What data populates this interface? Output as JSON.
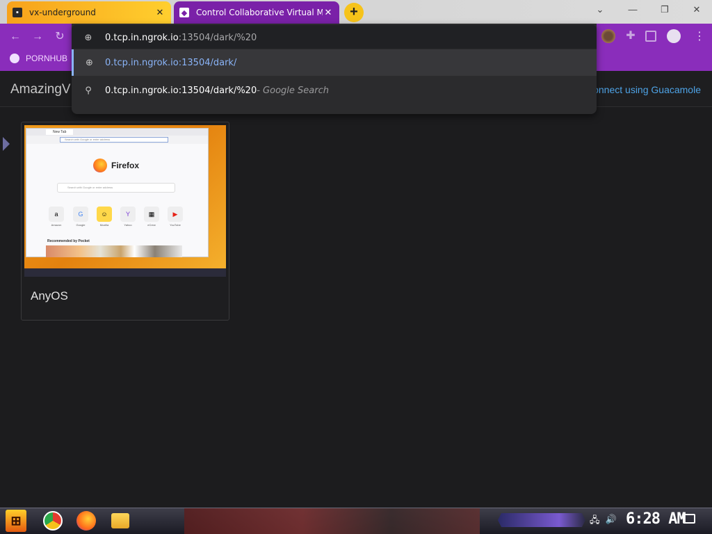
{
  "browser": {
    "tabs": [
      {
        "title": "vx-underground",
        "favicon": "vx-underground-icon"
      },
      {
        "title": "Control Collaborative Virtual M",
        "favicon": "shield-icon"
      }
    ],
    "close_glyph": "✕",
    "new_tab_glyph": "+",
    "window_controls": {
      "minimize": "—",
      "restore": "❐",
      "close": "✕",
      "chevron": "⌄"
    },
    "nav": {
      "back": "←",
      "forward": "→",
      "reload": "↻"
    },
    "bookmarks": [
      {
        "label": "PORNHUB"
      }
    ]
  },
  "omnibox": {
    "input": {
      "host": "0.tcp.in.ngrok.io",
      "rest": ":13504/dark/%20"
    },
    "suggestions": [
      {
        "type": "url",
        "text": "0.tcp.in.ngrok.io:13504/dark/",
        "selected": true
      },
      {
        "type": "search",
        "text": "0.tcp.in.ngrok.io:13504/dark/%20",
        "suffix": " - Google Search"
      }
    ]
  },
  "page": {
    "brand": "AmazingVM",
    "guacamole_link": "Connect using Guacamole",
    "cards": [
      {
        "name": "AnyOS"
      }
    ]
  },
  "thumbnail": {
    "tab_title": "New Tab",
    "brand": "Firefox",
    "search_placeholder": "Search with Google or enter address",
    "shortcuts": [
      {
        "label": "Amazon",
        "glyph": "a"
      },
      {
        "label": "Google",
        "glyph": "G"
      },
      {
        "label": "Mozilla",
        "glyph": "☺"
      },
      {
        "label": "Yahoo",
        "glyph": "Y"
      },
      {
        "label": "eCrew",
        "glyph": "▦"
      },
      {
        "label": "YouTube",
        "glyph": "▶"
      }
    ],
    "pocket_heading": "Recommended by Pocket"
  },
  "taskbar": {
    "start_glyph": "⊞",
    "clock": "6:28 AM",
    "tray": [
      "network-icon",
      "volume-icon"
    ]
  },
  "colors": {
    "accent_purple": "#8a2dbb",
    "tab_orange": "#f7a21b",
    "link_blue": "#8ab4f8",
    "page_bg": "#1c1c1e"
  }
}
